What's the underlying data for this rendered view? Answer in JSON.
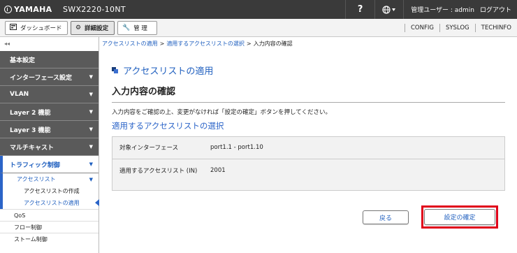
{
  "header": {
    "brand": "YAMAHA",
    "model": "SWX2220-10NT",
    "help": "?",
    "user_label": "管理ユーザー : admin",
    "logout": "ログアウト"
  },
  "tabs": [
    {
      "label": "ダッシュボード",
      "icon": "dashboard-icon"
    },
    {
      "label": "詳細設定",
      "icon": "gear-icon"
    },
    {
      "label": "管 理",
      "icon": "wrench-icon"
    }
  ],
  "toplinks": [
    "CONFIG",
    "SYSLOG",
    "TECHINFO"
  ],
  "sidebar": {
    "collapse": "◂◂",
    "items": [
      {
        "label": "基本設定"
      },
      {
        "label": "インターフェース設定"
      },
      {
        "label": "VLAN"
      },
      {
        "label": "Layer 2 機能"
      },
      {
        "label": "Layer 3 機能"
      },
      {
        "label": "マルチキャスト"
      },
      {
        "label": "トラフィック制御"
      }
    ],
    "sub": "アクセスリスト",
    "subsub": [
      "アクセスリストの作成",
      "アクセスリストの適用"
    ],
    "plain": [
      "QoS",
      "フロー制御",
      "ストーム制御"
    ]
  },
  "breadcrumb": {
    "c1": "アクセスリストの適用",
    "c2": "適用するアクセスリストの選択",
    "c3": "入力内容の確認",
    "sep": ">"
  },
  "main": {
    "title": "アクセスリストの適用",
    "section": "入力内容の確認",
    "description": "入力内容をご確認の上、変更がなければ「設定の確定」ボタンを押してください。",
    "subhead": "適用するアクセスリストの選択",
    "rows": [
      {
        "label": "対象インターフェース",
        "value": "port1.1 - port1.10"
      },
      {
        "label": "適用するアクセスリスト (IN)",
        "value": "2001"
      }
    ],
    "back": "戻る",
    "confirm": "設定の確定"
  },
  "colors": {
    "topbar": "#3a3a3a",
    "accent": "#2b64c8",
    "highlight": "#e0001a"
  }
}
